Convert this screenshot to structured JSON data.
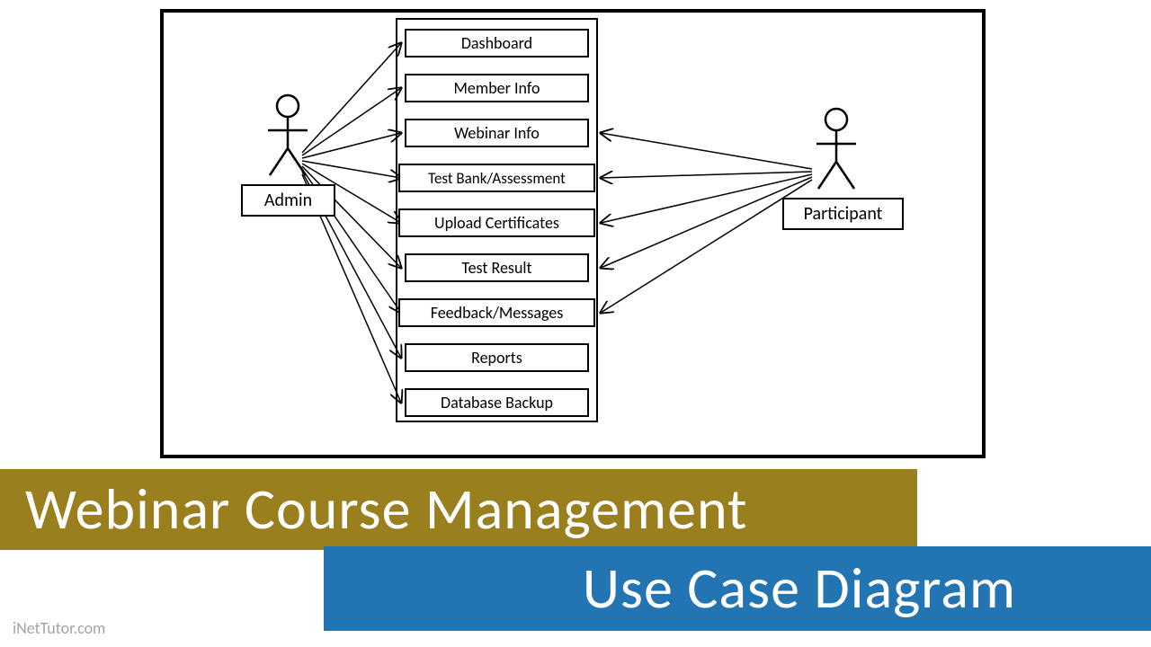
{
  "actors": {
    "admin": "Admin",
    "participant": "Participant"
  },
  "usecases": {
    "dashboard": "Dashboard",
    "member_info": "Member Info",
    "webinar_info": "Webinar Info",
    "test_bank": "Test Bank/Assessment",
    "upload_certs": "Upload Certificates",
    "test_result": "Test Result",
    "feedback": "Feedback/Messages",
    "reports": "Reports",
    "db_backup": "Database Backup"
  },
  "banner": {
    "line1": "Webinar Course Management",
    "line2": "Use Case Diagram"
  },
  "watermark": "iNetTutor.com"
}
